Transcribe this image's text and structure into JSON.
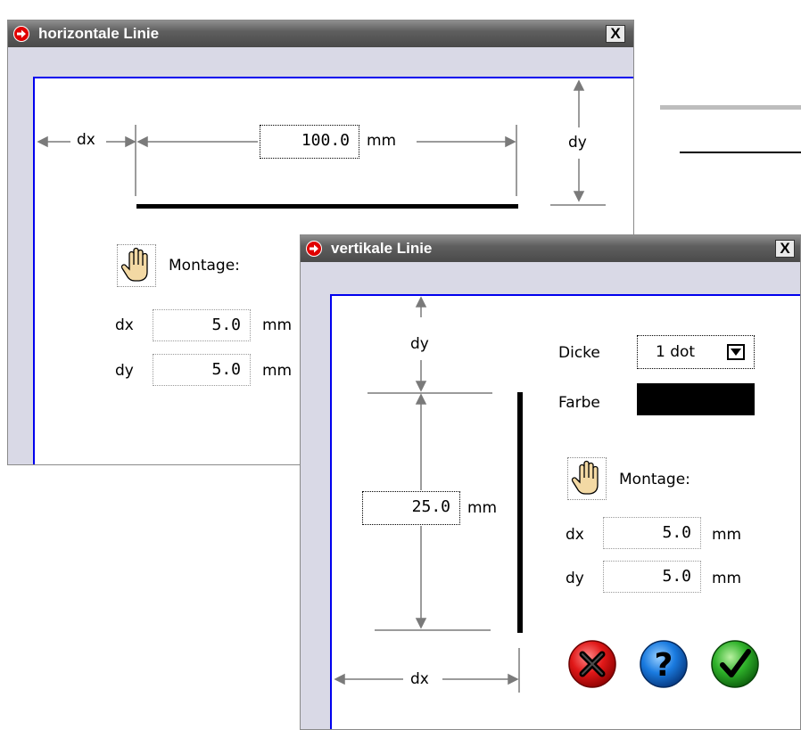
{
  "background_lines": {
    "color_gray": "#bdbdbd",
    "color_black": "#000000"
  },
  "horizontal_dialog": {
    "title": "horizontale Linie",
    "close_label": "X",
    "dx_label": "dx",
    "dy_label": "dy",
    "length_value": "100.0",
    "length_unit": "mm",
    "montage_label": "Montage:",
    "offset_dx_label": "dx",
    "offset_dx_value": "5.0",
    "offset_dx_unit": "mm",
    "offset_dy_label": "dy",
    "offset_dy_value": "5.0",
    "offset_dy_unit": "mm"
  },
  "vertical_dialog": {
    "title": "vertikale Linie",
    "close_label": "X",
    "dy_label": "dy",
    "dx_label": "dx",
    "length_value": "25.0",
    "length_unit": "mm",
    "thickness_label": "Dicke",
    "thickness_value": "1 dot",
    "color_label": "Farbe",
    "color_value": "#000000",
    "montage_label": "Montage:",
    "offset_dx_label": "dx",
    "offset_dx_value": "5.0",
    "offset_dx_unit": "mm",
    "offset_dy_label": "dy",
    "offset_dy_value": "5.0",
    "offset_dy_unit": "mm",
    "buttons": {
      "cancel_icon": "red-x-circle-icon",
      "help_icon": "blue-question-circle-icon",
      "ok_icon": "green-check-circle-icon"
    }
  }
}
